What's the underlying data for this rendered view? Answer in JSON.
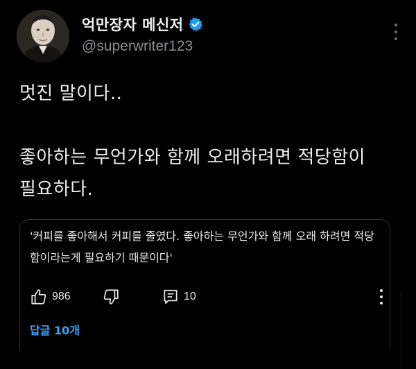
{
  "author": {
    "name": "억만장자 메신저",
    "handle": "@superwriter123",
    "verified": true,
    "verified_color": "#1d9bf0",
    "avatar_icon": "portrait-avatar"
  },
  "post": {
    "lines": [
      "멋진 말이다..",
      "좋아하는 무언가와 함께 오래하려면 적당함이",
      "필요하다."
    ]
  },
  "quote": {
    "text": "'커피를 좋아해서 커피를 줄였다. 좋아하는 무언가와 함께 오래 하려면 적당함이라는게 필요하기 때문이다'",
    "likes": "986",
    "replies": "10",
    "replies_link": "답글 10개",
    "link_color": "#3ea6ff"
  },
  "icons": {
    "like": "thumbs-up-icon",
    "dislike": "thumbs-down-icon",
    "reply": "comment-icon",
    "more": "more-vertical-icon"
  }
}
